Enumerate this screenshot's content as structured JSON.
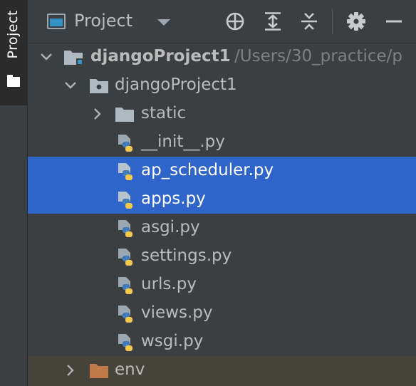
{
  "sidebar": {
    "tab_label": "Project",
    "icon": "folder-icon"
  },
  "header": {
    "title": "Project",
    "buttons": [
      {
        "icon": "locate-icon",
        "name": "select-opened-file"
      },
      {
        "icon": "expand-all-icon",
        "name": "expand-all"
      },
      {
        "icon": "collapse-all-icon",
        "name": "collapse-all"
      },
      {
        "icon": "gear-icon",
        "name": "settings"
      },
      {
        "icon": "minimize-icon",
        "name": "hide"
      }
    ]
  },
  "tree": {
    "root": {
      "name": "djangoProject1",
      "path": "/Users/30_practice/p"
    },
    "package": {
      "name": "djangoProject1"
    },
    "static_folder": {
      "name": "static"
    },
    "files": [
      {
        "name": "__init__.py",
        "selected": false
      },
      {
        "name": "ap_scheduler.py",
        "selected": true
      },
      {
        "name": "apps.py",
        "selected": true
      },
      {
        "name": "asgi.py",
        "selected": false
      },
      {
        "name": "settings.py",
        "selected": false
      },
      {
        "name": "urls.py",
        "selected": false
      },
      {
        "name": "views.py",
        "selected": false
      },
      {
        "name": "wsgi.py",
        "selected": false
      }
    ],
    "env_folder": {
      "name": "env"
    }
  },
  "colors": {
    "background": "#3c3f41",
    "selection": "#2f65ca",
    "excluded_row": "#45433a",
    "excluded_folder": "#c07a4a",
    "python_blue": "#3f7cba",
    "python_yellow": "#f2c94c"
  }
}
